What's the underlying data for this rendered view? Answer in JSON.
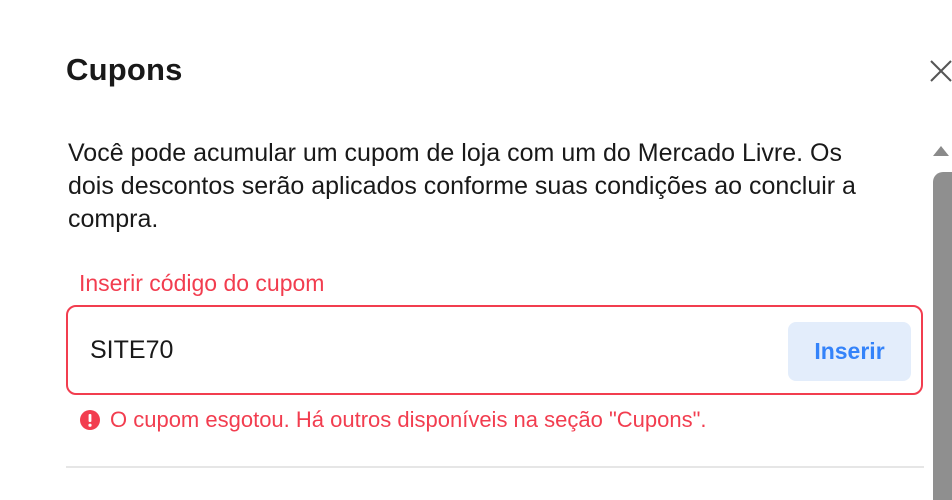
{
  "modal": {
    "title": "Cupons",
    "close_icon": "close-icon",
    "description": "Você pode acumular um cupom de loja com um do Mercado Livre. Os dois descontos serão aplicados conforme suas condições ao concluir a compra."
  },
  "coupon_field": {
    "label": "Inserir código do cupom",
    "value": "SITE70",
    "button_label": "Inserir",
    "error_icon": "exclamation-circle-icon",
    "error_message": "O cupom esgotou. Há outros disponíveis na seção \"Cupons\"."
  },
  "colors": {
    "error": "#f23d4f",
    "accent": "#3483fa",
    "button_background": "#e3edfb",
    "text": "#1a1a1a",
    "divider": "#e6e6e6"
  }
}
